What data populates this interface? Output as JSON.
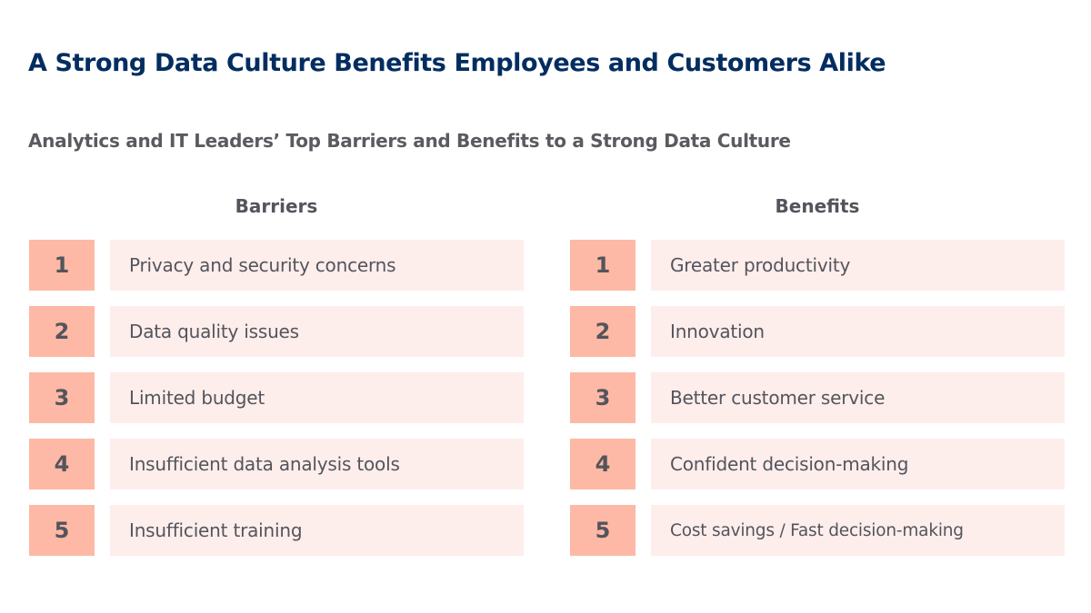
{
  "title": "A Strong Data Culture Benefits Employees and Customers Alike",
  "subtitle": "Analytics and IT Leaders’ Top Barriers and Benefits to a Strong Data Culture",
  "colors": {
    "title": "#032D60",
    "rank_box": "#FDB9A5",
    "label_box": "#FDEEEC",
    "text": "#54545C"
  },
  "barriers": {
    "heading": "Barriers",
    "items": [
      {
        "rank": "1",
        "label": "Privacy and security concerns"
      },
      {
        "rank": "2",
        "label": "Data quality issues"
      },
      {
        "rank": "3",
        "label": "Limited budget"
      },
      {
        "rank": "4",
        "label": "Insufficient data analysis tools"
      },
      {
        "rank": "5",
        "label": "Insufficient training"
      }
    ]
  },
  "benefits": {
    "heading": "Benefits",
    "items": [
      {
        "rank": "1",
        "label": "Greater productivity"
      },
      {
        "rank": "2",
        "label": "Innovation"
      },
      {
        "rank": "3",
        "label": "Better customer service"
      },
      {
        "rank": "4",
        "label": "Confident decision-making"
      },
      {
        "rank": "5",
        "label": "Cost savings / Fast decision-making"
      }
    ]
  }
}
